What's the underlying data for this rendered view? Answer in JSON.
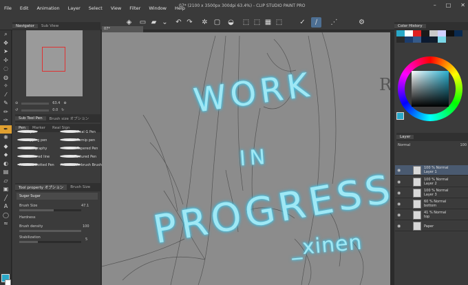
{
  "menu": [
    "File",
    "Edit",
    "Animation",
    "Layer",
    "Select",
    "View",
    "Filter",
    "Window",
    "Help"
  ],
  "window_title": "07* (2100 x 3500px 300dpi 63.4%) - CLIP STUDIO PAINT PRO",
  "window_controls": [
    "minimize",
    "maximize",
    "close"
  ],
  "navigator": {
    "tabs": [
      "Navigator",
      "Sub View"
    ],
    "zoom": "63.4",
    "angle": "0.0"
  },
  "subtool": {
    "tabs": [
      "Sub Tool Pen",
      "Brush size オプション"
    ],
    "groups": [
      "Pen",
      "Marker",
      "Real Sign"
    ]
  },
  "brushes": [
    "G-pen",
    "Real G Pen",
    "Mapping pen",
    "Turnip pen",
    "Calligraphy",
    "Tapered Pen",
    "Textured line",
    "Textured Pen",
    "Pressure Dotted Pen",
    "Pressure Airbrush Brush"
  ],
  "tool_property": {
    "tabs": [
      "Tool property オプション",
      "Brush Size"
    ],
    "brush_name": "Sugar Sugar",
    "size_label": "Brush Size",
    "size_value": "47.1",
    "hardness_label": "Hardness",
    "density_label": "Brush density",
    "density_value": "100",
    "stabilization_label": "Stabilization",
    "stabilization_value": "5"
  },
  "canvas_tab": "07*",
  "canvas_text": [
    "WORK",
    "IN",
    "PROGRESS",
    "_xinen"
  ],
  "canvas_letter": "R",
  "color_history": "Color History",
  "layer_panel": {
    "tab": "Layer",
    "blend": "Normal",
    "opacity": "100"
  },
  "layers": [
    {
      "line1": "100 % Normal",
      "line2": "Layer 1",
      "selected": true
    },
    {
      "line1": "100 % Normal",
      "line2": "Layer 2",
      "selected": false
    },
    {
      "line1": "100 % Normal",
      "line2": "Layer 3",
      "selected": false
    },
    {
      "line1": "60 % Normal",
      "line2": "bottom",
      "selected": false
    },
    {
      "line1": "41 % Normal",
      "line2": "top",
      "selected": false
    },
    {
      "line1": "Paper",
      "line2": "",
      "selected": false
    }
  ],
  "colors": {
    "accent": "#2aa8c8",
    "selected_tool": "#e0a030",
    "glow": "#9fe8f5"
  }
}
